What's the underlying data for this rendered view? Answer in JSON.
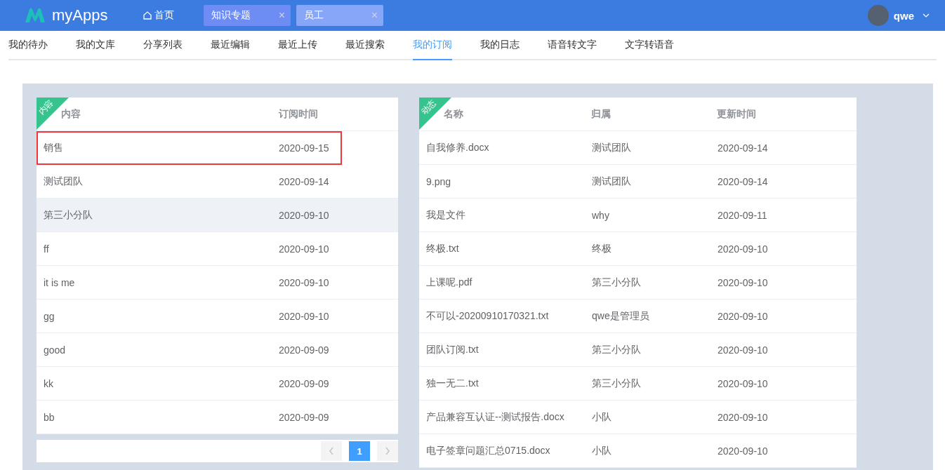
{
  "header": {
    "logo": "myApps",
    "home": "首页",
    "tabs": [
      {
        "label": "知识专题",
        "selected": true,
        "close": "×"
      },
      {
        "label": "员工",
        "selected": false,
        "close": "×"
      }
    ],
    "user": "qwe"
  },
  "nav": [
    {
      "label": "我的待办",
      "selected": false
    },
    {
      "label": "我的文库",
      "selected": false
    },
    {
      "label": "分享列表",
      "selected": false
    },
    {
      "label": "最近编辑",
      "selected": false
    },
    {
      "label": "最近上传",
      "selected": false
    },
    {
      "label": "最近搜索",
      "selected": false
    },
    {
      "label": "我的订阅",
      "selected": true
    },
    {
      "label": "我的日志",
      "selected": false
    },
    {
      "label": "语音转文字",
      "selected": false
    },
    {
      "label": "文字转语音",
      "selected": false
    }
  ],
  "subscriptions": {
    "ribbon": "内容",
    "columns": [
      "内容",
      "订阅时间"
    ],
    "rows": [
      {
        "cells": [
          "销售",
          "2020-09-15"
        ],
        "outlined": true,
        "highlighted": false
      },
      {
        "cells": [
          "测试团队",
          "2020-09-14"
        ],
        "outlined": false,
        "highlighted": false
      },
      {
        "cells": [
          "第三小分队",
          "2020-09-10"
        ],
        "outlined": false,
        "highlighted": true
      },
      {
        "cells": [
          "ff",
          "2020-09-10"
        ],
        "outlined": false,
        "highlighted": false
      },
      {
        "cells": [
          "it is me",
          "2020-09-10"
        ],
        "outlined": false,
        "highlighted": false
      },
      {
        "cells": [
          "gg",
          "2020-09-10"
        ],
        "outlined": false,
        "highlighted": false
      },
      {
        "cells": [
          "good",
          "2020-09-09"
        ],
        "outlined": false,
        "highlighted": false
      },
      {
        "cells": [
          "kk",
          "2020-09-09"
        ],
        "outlined": false,
        "highlighted": false
      },
      {
        "cells": [
          "bb",
          "2020-09-09"
        ],
        "outlined": false,
        "highlighted": false
      }
    ],
    "pages": [
      {
        "label": "1",
        "selected": true
      }
    ]
  },
  "updates": {
    "ribbon": "动态",
    "columns": [
      "名称",
      "归属",
      "更新时间"
    ],
    "rows": [
      [
        "自我修养.docx",
        "测试团队",
        "2020-09-14"
      ],
      [
        "9.png",
        "测试团队",
        "2020-09-14"
      ],
      [
        "我是文件",
        "why",
        "2020-09-11"
      ],
      [
        "终极.txt",
        "终极",
        "2020-09-10"
      ],
      [
        "上课呢.pdf",
        "第三小分队",
        "2020-09-10"
      ],
      [
        "不可以-20200910170321.txt",
        "qwe是管理员",
        "2020-09-10"
      ],
      [
        "团队订阅.txt",
        "第三小分队",
        "2020-09-10"
      ],
      [
        "独一无二.txt",
        "第三小分队",
        "2020-09-10"
      ],
      [
        "产品兼容互认证--测试报告.docx",
        "小队",
        "2020-09-10"
      ],
      [
        "电子签章问题汇总0715.docx",
        "小队",
        "2020-09-10"
      ]
    ]
  }
}
